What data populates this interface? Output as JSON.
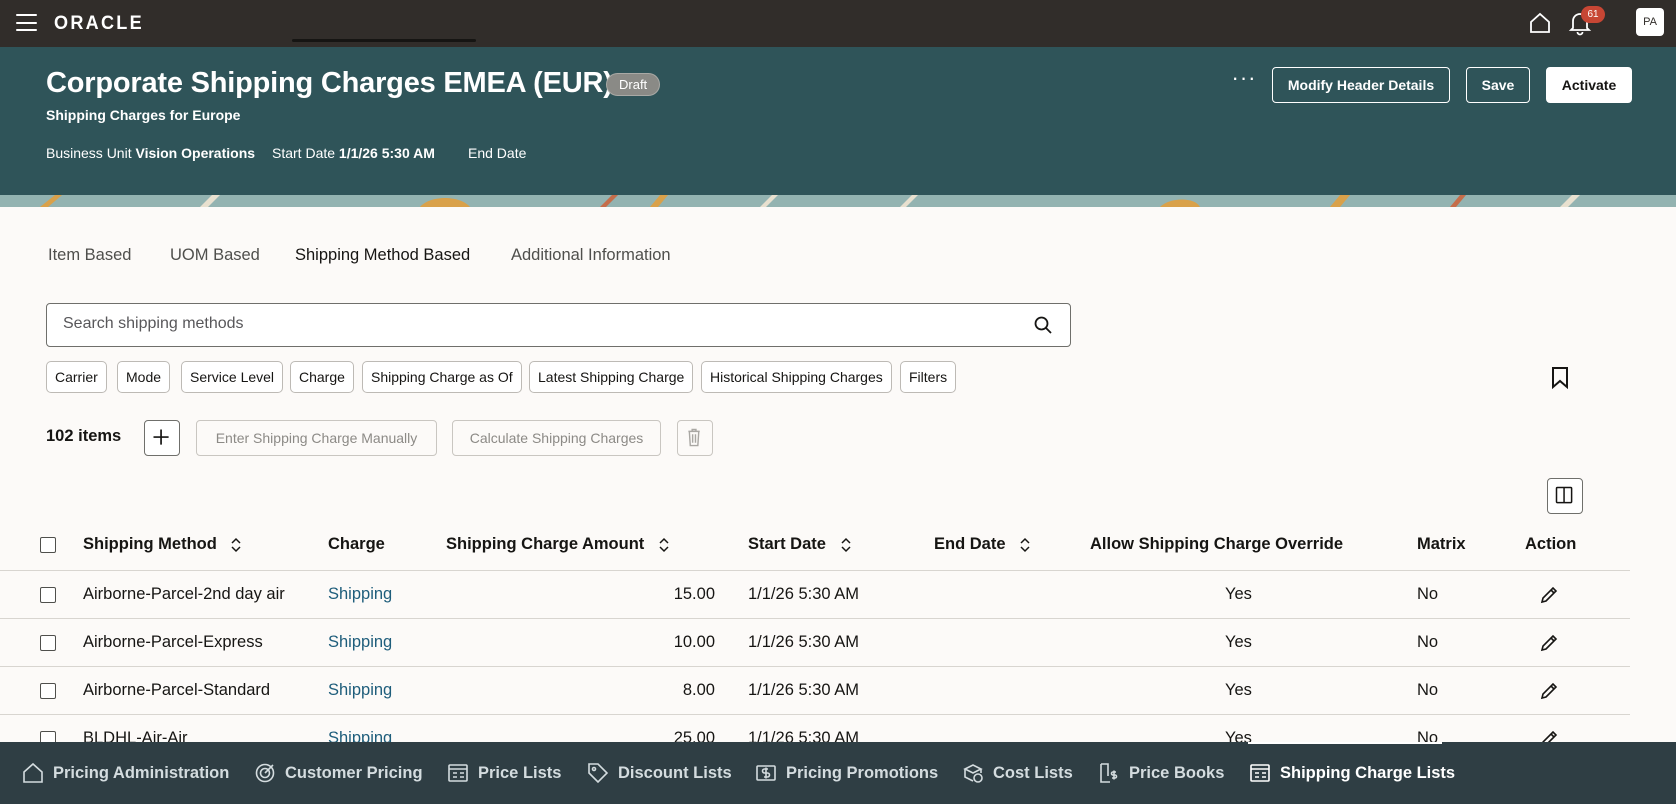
{
  "topbar": {
    "logo": "ORACLE",
    "notification_count": "61",
    "avatar_initials": "PA"
  },
  "header": {
    "title": "Corporate Shipping Charges EMEA (EUR)",
    "status": "Draft",
    "subtitle": "Shipping Charges for Europe",
    "business_unit_label": "Business Unit",
    "business_unit_value": "Vision Operations",
    "start_date_label": "Start Date",
    "start_date_value": "1/1/26 5:30 AM",
    "end_date_label": "End Date",
    "end_date_value": "",
    "more_label": "···",
    "modify_button": "Modify Header Details",
    "save_button": "Save",
    "activate_button": "Activate"
  },
  "tabs": [
    {
      "label": "Item Based"
    },
    {
      "label": "UOM Based"
    },
    {
      "label": "Shipping Method Based"
    },
    {
      "label": "Additional Information"
    }
  ],
  "search": {
    "placeholder": "Search shipping methods",
    "value": ""
  },
  "filters": [
    {
      "label": "Carrier"
    },
    {
      "label": "Mode"
    },
    {
      "label": "Service Level"
    },
    {
      "label": "Charge"
    },
    {
      "label": "Shipping Charge as Of"
    },
    {
      "label": "Latest Shipping Charge"
    },
    {
      "label": "Historical Shipping Charges"
    },
    {
      "label": "Filters"
    }
  ],
  "toolbar": {
    "items_count": "102 items",
    "enter_manual": "Enter Shipping Charge Manually",
    "calculate": "Calculate Shipping Charges"
  },
  "table": {
    "columns": {
      "shipping_method": "Shipping Method",
      "charge": "Charge",
      "amount": "Shipping Charge Amount",
      "start_date": "Start Date",
      "end_date": "End Date",
      "override": "Allow Shipping Charge Override",
      "matrix": "Matrix",
      "action": "Action"
    },
    "rows": [
      {
        "method": "Airborne-Parcel-2nd day air",
        "charge": "Shipping",
        "amount": "15.00",
        "start": "1/1/26 5:30 AM",
        "end": "",
        "override": "Yes",
        "matrix": "No"
      },
      {
        "method": "Airborne-Parcel-Express",
        "charge": "Shipping",
        "amount": "10.00",
        "start": "1/1/26 5:30 AM",
        "end": "",
        "override": "Yes",
        "matrix": "No"
      },
      {
        "method": "Airborne-Parcel-Standard",
        "charge": "Shipping",
        "amount": "8.00",
        "start": "1/1/26 5:30 AM",
        "end": "",
        "override": "Yes",
        "matrix": "No"
      },
      {
        "method": "BLDHL-Air-Air",
        "charge": "Shipping",
        "amount": "25.00",
        "start": "1/1/26 5:30 AM",
        "end": "",
        "override": "Yes",
        "matrix": "No"
      }
    ]
  },
  "bottom_nav": [
    {
      "label": "Pricing Administration",
      "icon": "home-icon"
    },
    {
      "label": "Customer Pricing",
      "icon": "target-icon"
    },
    {
      "label": "Price Lists",
      "icon": "price-list-icon"
    },
    {
      "label": "Discount Lists",
      "icon": "tag-icon"
    },
    {
      "label": "Pricing Promotions",
      "icon": "promotion-icon"
    },
    {
      "label": "Cost Lists",
      "icon": "cost-icon"
    },
    {
      "label": "Price Books",
      "icon": "price-book-icon"
    },
    {
      "label": "Shipping Charge Lists",
      "icon": "shipping-list-icon"
    }
  ]
}
